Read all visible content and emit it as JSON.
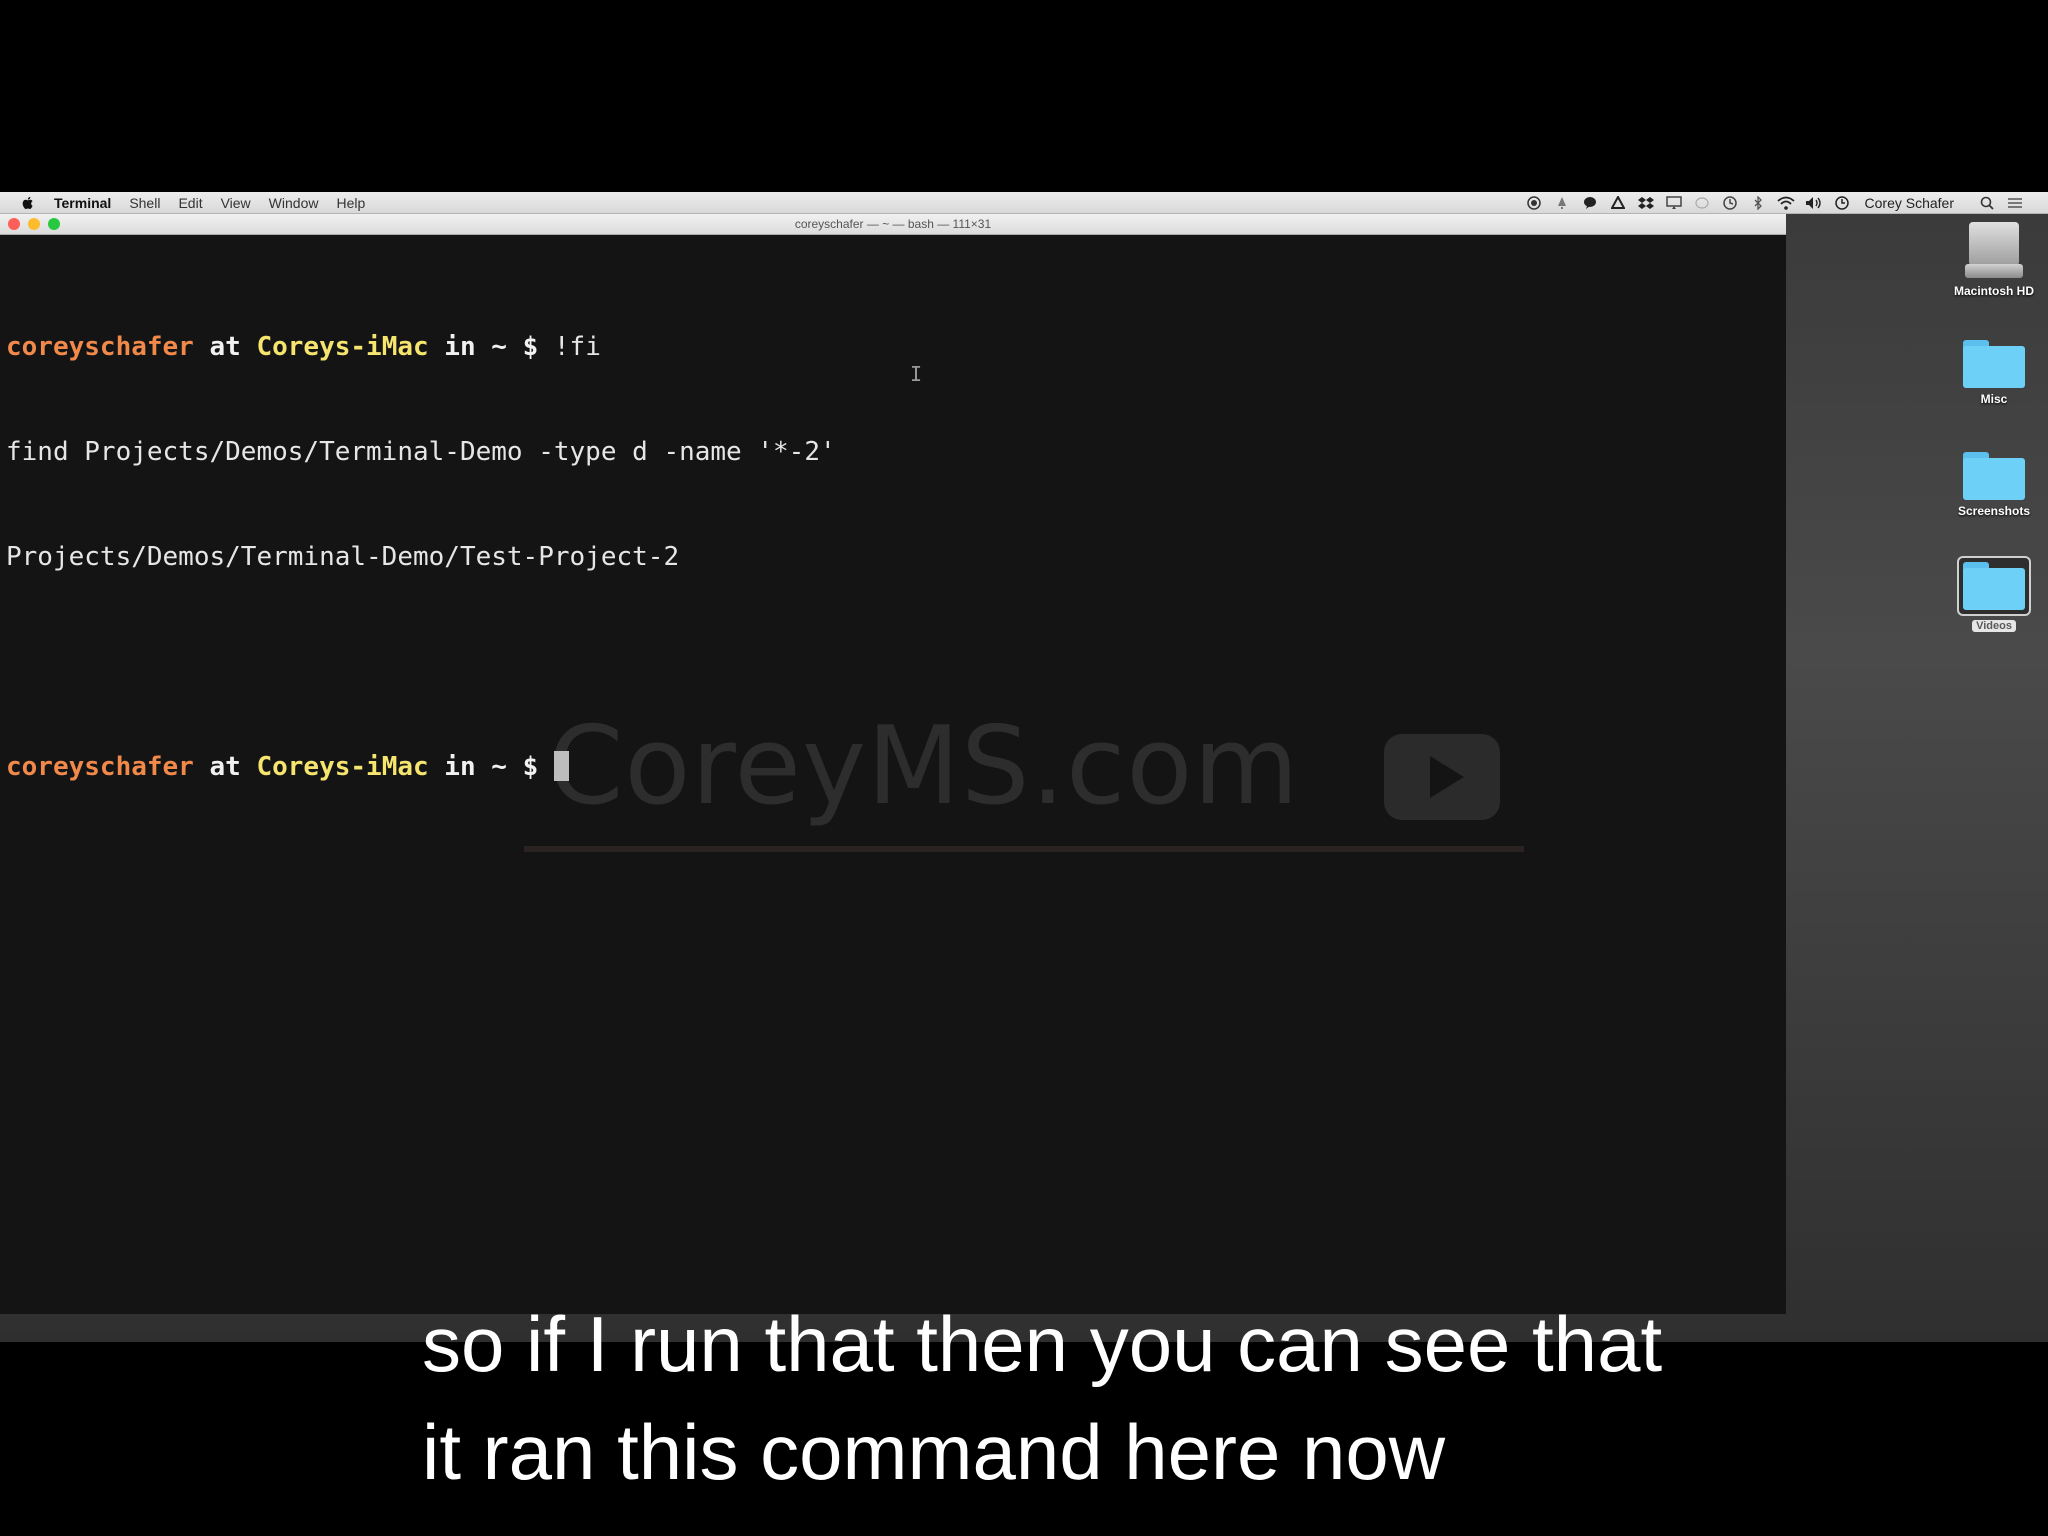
{
  "menubar": {
    "app_name": "Terminal",
    "menus": [
      "Shell",
      "Edit",
      "View",
      "Window",
      "Help"
    ],
    "user_name": "Corey Schafer"
  },
  "window": {
    "title": "coreyschafer — ~ — bash — 111×31"
  },
  "terminal": {
    "prompt_user": "coreyschafer",
    "prompt_at": " at ",
    "prompt_host": "Coreys-iMac",
    "prompt_in": " in ",
    "prompt_dir": "~",
    "prompt_symbol": " $ ",
    "command": "!fi",
    "expanded_command": "find Projects/Demos/Terminal-Demo -type d -name '*-2'",
    "output": "Projects/Demos/Terminal-Demo/Test-Project-2"
  },
  "watermark": {
    "text": "CoreyMS.com"
  },
  "desktop": {
    "items": [
      {
        "label": "Macintosh HD",
        "icon": "hard-drive-icon"
      },
      {
        "label": "Misc",
        "icon": "folder-icon"
      },
      {
        "label": "Screenshots",
        "icon": "folder-icon"
      },
      {
        "label": "Videos",
        "icon": "folder-icon",
        "selected": true
      }
    ]
  },
  "subtitles": {
    "line1": "so if I run that then you can see that",
    "line2": "it ran this command here now"
  },
  "colors": {
    "prompt_user": "#f0894a",
    "prompt_host": "#f5e56e",
    "terminal_bg": "#141414",
    "folder": "#6dd0f6"
  }
}
